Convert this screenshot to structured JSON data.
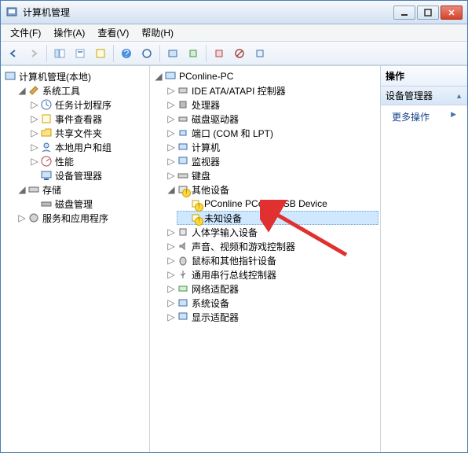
{
  "window": {
    "title": "计算机管理"
  },
  "menu": {
    "file": "文件(F)",
    "action": "操作(A)",
    "view": "查看(V)",
    "help": "帮助(H)"
  },
  "left_tree": {
    "root": "计算机管理(本地)",
    "system_tools": "系统工具",
    "task_scheduler": "任务计划程序",
    "event_viewer": "事件查看器",
    "shared_folders": "共享文件夹",
    "local_users": "本地用户和组",
    "performance": "性能",
    "device_manager": "设备管理器",
    "storage": "存储",
    "disk_management": "磁盘管理",
    "services": "服务和应用程序"
  },
  "device_tree": {
    "root": "PConline-PC",
    "ide": "IDE ATA/ATAPI 控制器",
    "cpu": "处理器",
    "disk_drives": "磁盘驱动器",
    "ports": "端口 (COM 和 LPT)",
    "computer": "计算机",
    "monitor": "监视器",
    "keyboard": "键盘",
    "other": "其他设备",
    "usb_device": "PConline PCedu USB Device",
    "unknown": "未知设备",
    "hid": "人体学输入设备",
    "sound": "声音、视频和游戏控制器",
    "mouse": "鼠标和其他指针设备",
    "usb_ctrl": "通用串行总线控制器",
    "network": "网络适配器",
    "system_dev": "系统设备",
    "display": "显示适配器"
  },
  "actions": {
    "header": "操作",
    "subheader": "设备管理器",
    "more": "更多操作"
  }
}
